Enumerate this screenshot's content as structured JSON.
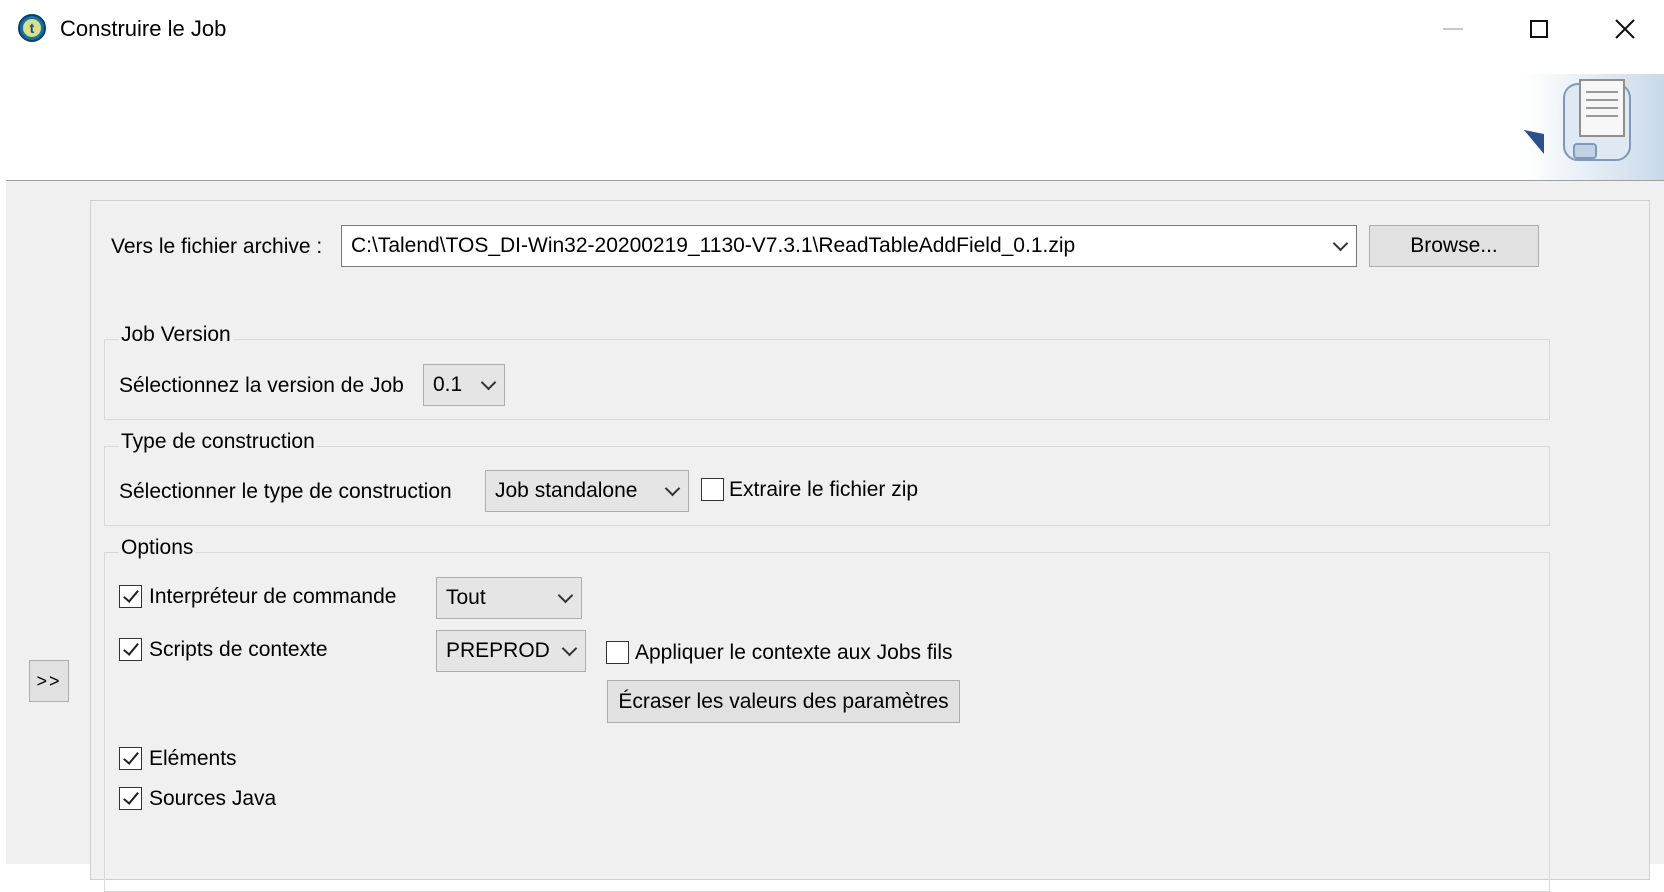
{
  "window": {
    "title": "Construire le Job"
  },
  "icons": {
    "app": "talend-app-icon",
    "minimize": "minimize-icon",
    "maximize": "maximize-icon",
    "close": "close-icon",
    "wizard": "export-job-wizard-icon",
    "toggle": "expand-panel-icon"
  },
  "toggle_label": ">>",
  "archive": {
    "label": "Vers le fichier archive :",
    "value": "C:\\Talend\\TOS_DI-Win32-20200219_1130-V7.3.1\\ReadTableAddField_0.1.zip",
    "browse_label": "Browse..."
  },
  "job_version": {
    "title": "Job Version",
    "label": "Sélectionnez la version de Job",
    "value": "0.1"
  },
  "build_type": {
    "title": "Type de construction",
    "label": "Sélectionner le type de construction",
    "value": "Job standalone",
    "extract_zip_label": "Extraire le fichier zip",
    "extract_zip_checked": false
  },
  "options": {
    "title": "Options",
    "shell_label": "Interpréteur de commande",
    "shell_checked": true,
    "shell_value": "Tout",
    "context_scripts_label": "Scripts de contexte",
    "context_scripts_checked": true,
    "context_value": "PREPROD",
    "apply_context_label": "Appliquer le contexte aux Jobs fils",
    "apply_context_checked": false,
    "override_params_label": "Écraser les valeurs des paramètres",
    "items_label": "Eléments",
    "items_checked": true,
    "java_sources_label": "Sources Java",
    "java_sources_checked": true
  }
}
